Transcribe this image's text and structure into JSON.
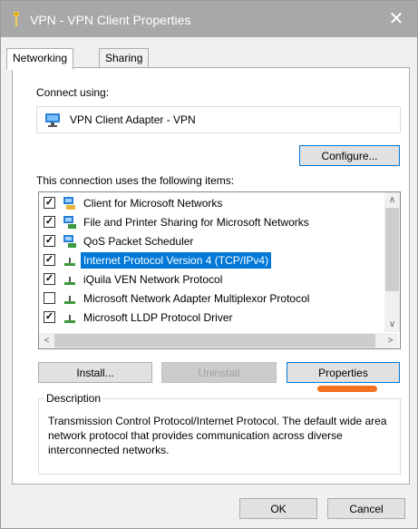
{
  "window": {
    "title": "VPN - VPN Client Properties",
    "close_glyph": "✕",
    "icon": "network-pin-icon"
  },
  "tabs": [
    {
      "label": "Networking",
      "active": true
    },
    {
      "label": "Sharing",
      "active": false
    }
  ],
  "connect": {
    "label": "Connect using:",
    "adapter_name": "VPN Client Adapter - VPN",
    "adapter_icon": "network-adapter-icon",
    "configure_label": "Configure..."
  },
  "items_section": {
    "label": "This connection uses the following items:",
    "items": [
      {
        "label": "Client for Microsoft Networks",
        "checked": true,
        "icon": "network-client-icon",
        "selected": false
      },
      {
        "label": "File and Printer Sharing for Microsoft Networks",
        "checked": true,
        "icon": "network-service-icon",
        "selected": false
      },
      {
        "label": "QoS Packet Scheduler",
        "checked": true,
        "icon": "network-service-icon",
        "selected": false
      },
      {
        "label": "Internet Protocol Version 4 (TCP/IPv4)",
        "checked": true,
        "icon": "protocol-icon",
        "selected": true
      },
      {
        "label": "iQuila VEN Network Protocol",
        "checked": true,
        "icon": "protocol-icon",
        "selected": false
      },
      {
        "label": "Microsoft Network Adapter Multiplexor Protocol",
        "checked": false,
        "icon": "protocol-icon",
        "selected": false
      },
      {
        "label": "Microsoft LLDP Protocol Driver",
        "checked": true,
        "icon": "protocol-icon",
        "selected": false
      }
    ]
  },
  "actions": {
    "install_label": "Install...",
    "uninstall_label": "Uninstall",
    "properties_label": "Properties"
  },
  "description": {
    "legend": "Description",
    "text": "Transmission Control Protocol/Internet Protocol. The default wide area network protocol that provides communication across diverse interconnected networks."
  },
  "footer": {
    "ok_label": "OK",
    "cancel_label": "Cancel"
  },
  "colors": {
    "selection": "#0078d7",
    "annotation_underline": "#f3701f",
    "titlebar": "#a8a8a8"
  }
}
